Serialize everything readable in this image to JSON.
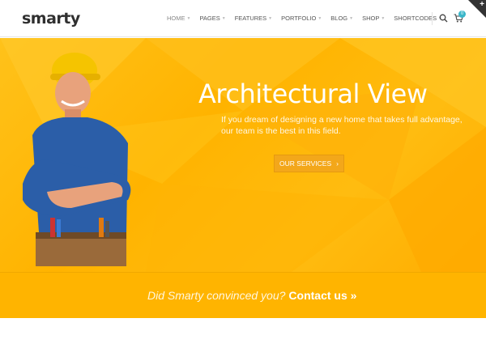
{
  "header": {
    "logo": "smarty",
    "nav": [
      {
        "label": "HOME",
        "active": true
      },
      {
        "label": "PAGES",
        "active": false
      },
      {
        "label": "FEATURES",
        "active": false
      },
      {
        "label": "PORTFOLIO",
        "active": false
      },
      {
        "label": "BLOG",
        "active": false
      },
      {
        "label": "SHOP",
        "active": false
      },
      {
        "label": "SHORTCODES",
        "active": false
      }
    ],
    "cart_count": "0"
  },
  "hero": {
    "title": "Architectural View",
    "description_line1": "If you dream of designing a new home that takes full advantage,",
    "description_line2": "our team is the best in this field.",
    "button_label": "OUR SERVICES",
    "button_arrow": "›"
  },
  "cta": {
    "text": "Did Smarty convinced you?",
    "link_label": "Contact us »"
  },
  "colors": {
    "hero_yellow": "#ffb800",
    "accent_teal": "#3ab6c9",
    "button_orange": "#f3a71a"
  }
}
